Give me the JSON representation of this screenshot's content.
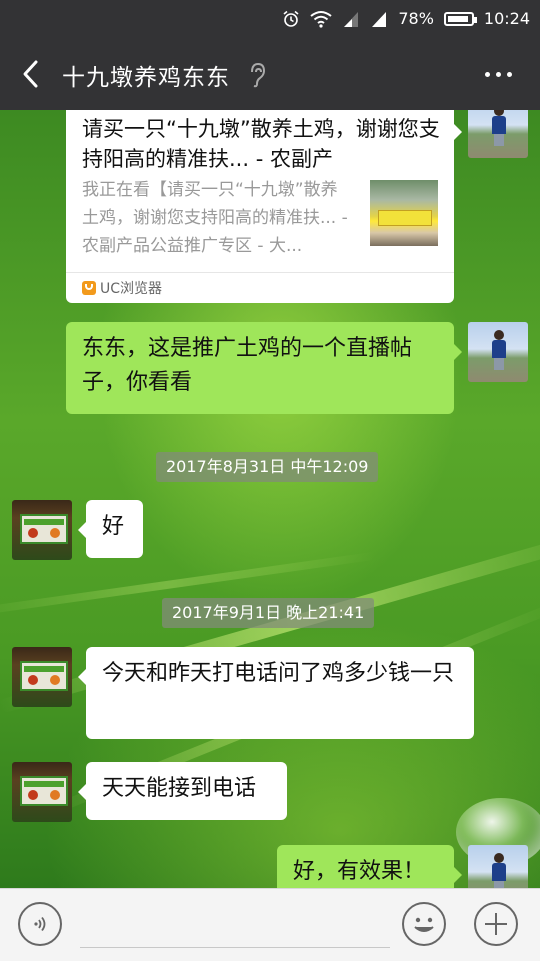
{
  "status_bar": {
    "battery_percent": "78%",
    "time": "10:24",
    "icons": [
      "alarm-icon",
      "wifi-icon",
      "signal-icon",
      "signal-icon",
      "battery-icon"
    ]
  },
  "header": {
    "title": "十九墩养鸡东东",
    "back_icon": "chevron-left-icon",
    "ear_icon": "earpiece-icon",
    "more_icon": "more-dots-icon"
  },
  "messages": {
    "link_card": {
      "title": "请买一只“十九墩”散养土鸡，谢谢您支持阳高的精准扶... - 农副产",
      "desc": "我正在看【请买一只“十九墩”散养土鸡，谢谢您支持阳高的精准扶... - 农副产品公益推广专区 - 大...",
      "source": "UC浏览器"
    },
    "m1": "东东，这是推广土鸡的一个直播帖子，你看看",
    "t1": "2017年8月31日 中午12:09",
    "m2": "好",
    "t2": "2017年9月1日 晚上21:41",
    "m3": "今天和昨天打电话问了鸡多少钱一只",
    "m4": "天天能接到电话",
    "m5": "好，有效果！"
  },
  "input_bar": {
    "voice_icon": "voice-icon",
    "emoji_icon": "emoji-icon",
    "plus_icon": "plus-icon"
  }
}
